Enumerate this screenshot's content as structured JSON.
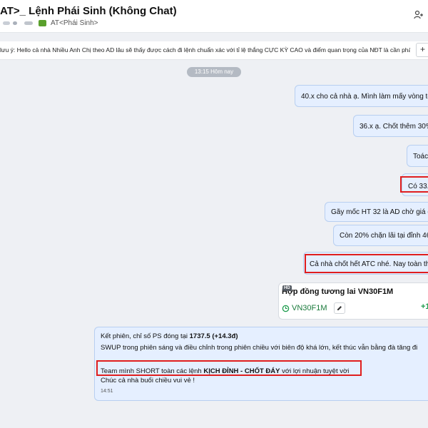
{
  "header": {
    "title": "AT>_ Lệnh Phái Sinh (Không Chat)",
    "group_label": "AT<Phái Sinh>"
  },
  "pinned": {
    "text": "lưu ý: Hello cả nhà Nhiều Anh Chị theo AD lâu sẽ thấy được cách đi lệnh chuẩn xác với tỉ lệ thắng CỰC KỲ CAO và điểm quan trọng của NĐT là cần phải ...",
    "button_label": "+"
  },
  "chat": {
    "time_chip": "13:15 Hôm nay",
    "messages": [
      "40.x cho cả nhà ạ. Mình làm mấy vòng toà",
      "36.x ạ. Chốt thêm 30%",
      "Toác",
      "Có 33.",
      "Gãy mốc HT 32 là AD chờ giá đ",
      "Còn 20% chặn lãi tại đỉnh 46",
      "Cả nhà chốt hết ATC nhé. Nay toàn thà"
    ],
    "card": {
      "badge": "HD",
      "title": "Hợp đồng tương lai VN30F1M",
      "symbol": "VN30F1M",
      "change": "+1"
    },
    "summary": {
      "line1_pre": "Kết phiên, chỉ số PS đóng tại ",
      "line1_bold": "1737.5 (+14.3đ)",
      "line2": "SWUP trong phiên sáng và điều chỉnh trong phiên chiều với biên độ khá lớn, kết thúc vẫn bằng đà tăng đi",
      "line3_pre": "Team mình SHORT toàn các lệnh ",
      "line3_bold": "KỊCH ĐỈNH - CHỐT ĐÁY",
      "line3_post": " với lợi nhuận tuyệt vời",
      "line4": "Chúc cả nhà buổi chiều vui vẻ !",
      "time": "14:51"
    }
  },
  "colors": {
    "bubble": "#e5efff",
    "highlight": "#e01e1e",
    "positive": "#1a9a4a"
  }
}
